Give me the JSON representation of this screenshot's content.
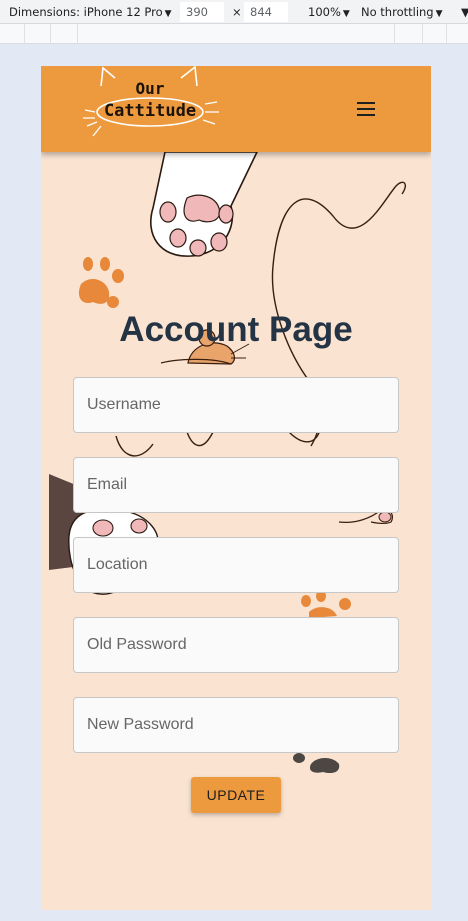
{
  "devtools": {
    "dimensions_label": "Dimensions: iPhone 12 Pro",
    "width": "390",
    "times": "×",
    "height": "844",
    "zoom": "100%",
    "throttling": "No throttling"
  },
  "header": {
    "logo_line1": "Our",
    "logo_line2": "Cattitude",
    "menu_icon": "hamburger-menu-icon",
    "color": "#ed9a3f"
  },
  "page": {
    "title": "Account Page",
    "background": "#fae3d1"
  },
  "form": {
    "username_placeholder": "Username",
    "email_placeholder": "Email",
    "location_placeholder": "Location",
    "old_password_placeholder": "Old Password",
    "new_password_placeholder": "New Password",
    "submit_label": "UPDATE"
  },
  "icons": [
    "cat-paw-icon",
    "paw-print-icon",
    "mouse-icon",
    "cat-tail-icon"
  ]
}
